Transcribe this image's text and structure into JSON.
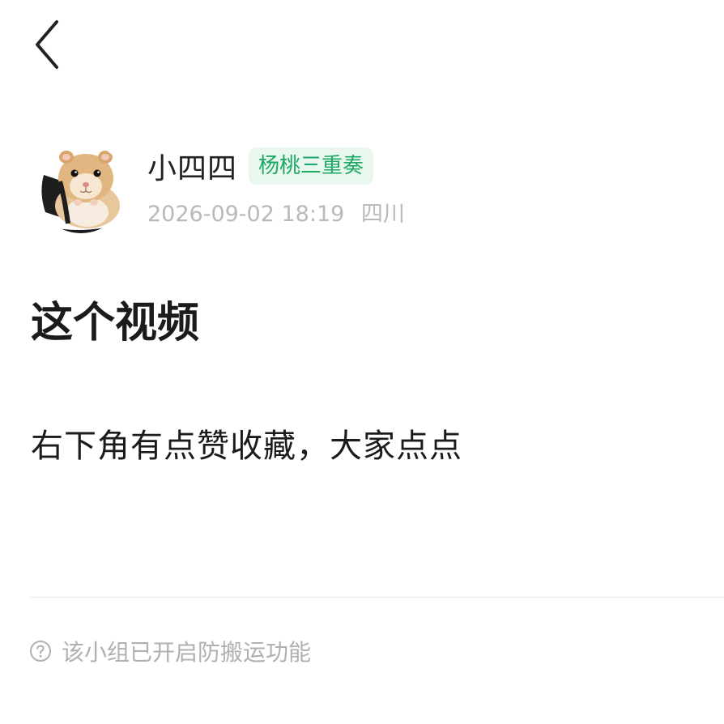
{
  "header": {
    "back_icon": "chevron-left-icon"
  },
  "post": {
    "author": {
      "avatar_icon": "hamster-avatar",
      "name": "小四四",
      "group_badge": "杨桃三重奏"
    },
    "datetime": "2026-09-02 18:19",
    "location": "四川",
    "title": "这个视频",
    "body": "右下角有点赞收藏，大家点点"
  },
  "footer": {
    "notice_icon": "question-circle-icon",
    "notice_text": "该小组已开启防搬运功能"
  },
  "colors": {
    "badge_text": "#1fa865",
    "badge_bg": "#e8f8ef",
    "meta_text": "#b9b9b9",
    "notice_text": "#b0b0b0"
  }
}
